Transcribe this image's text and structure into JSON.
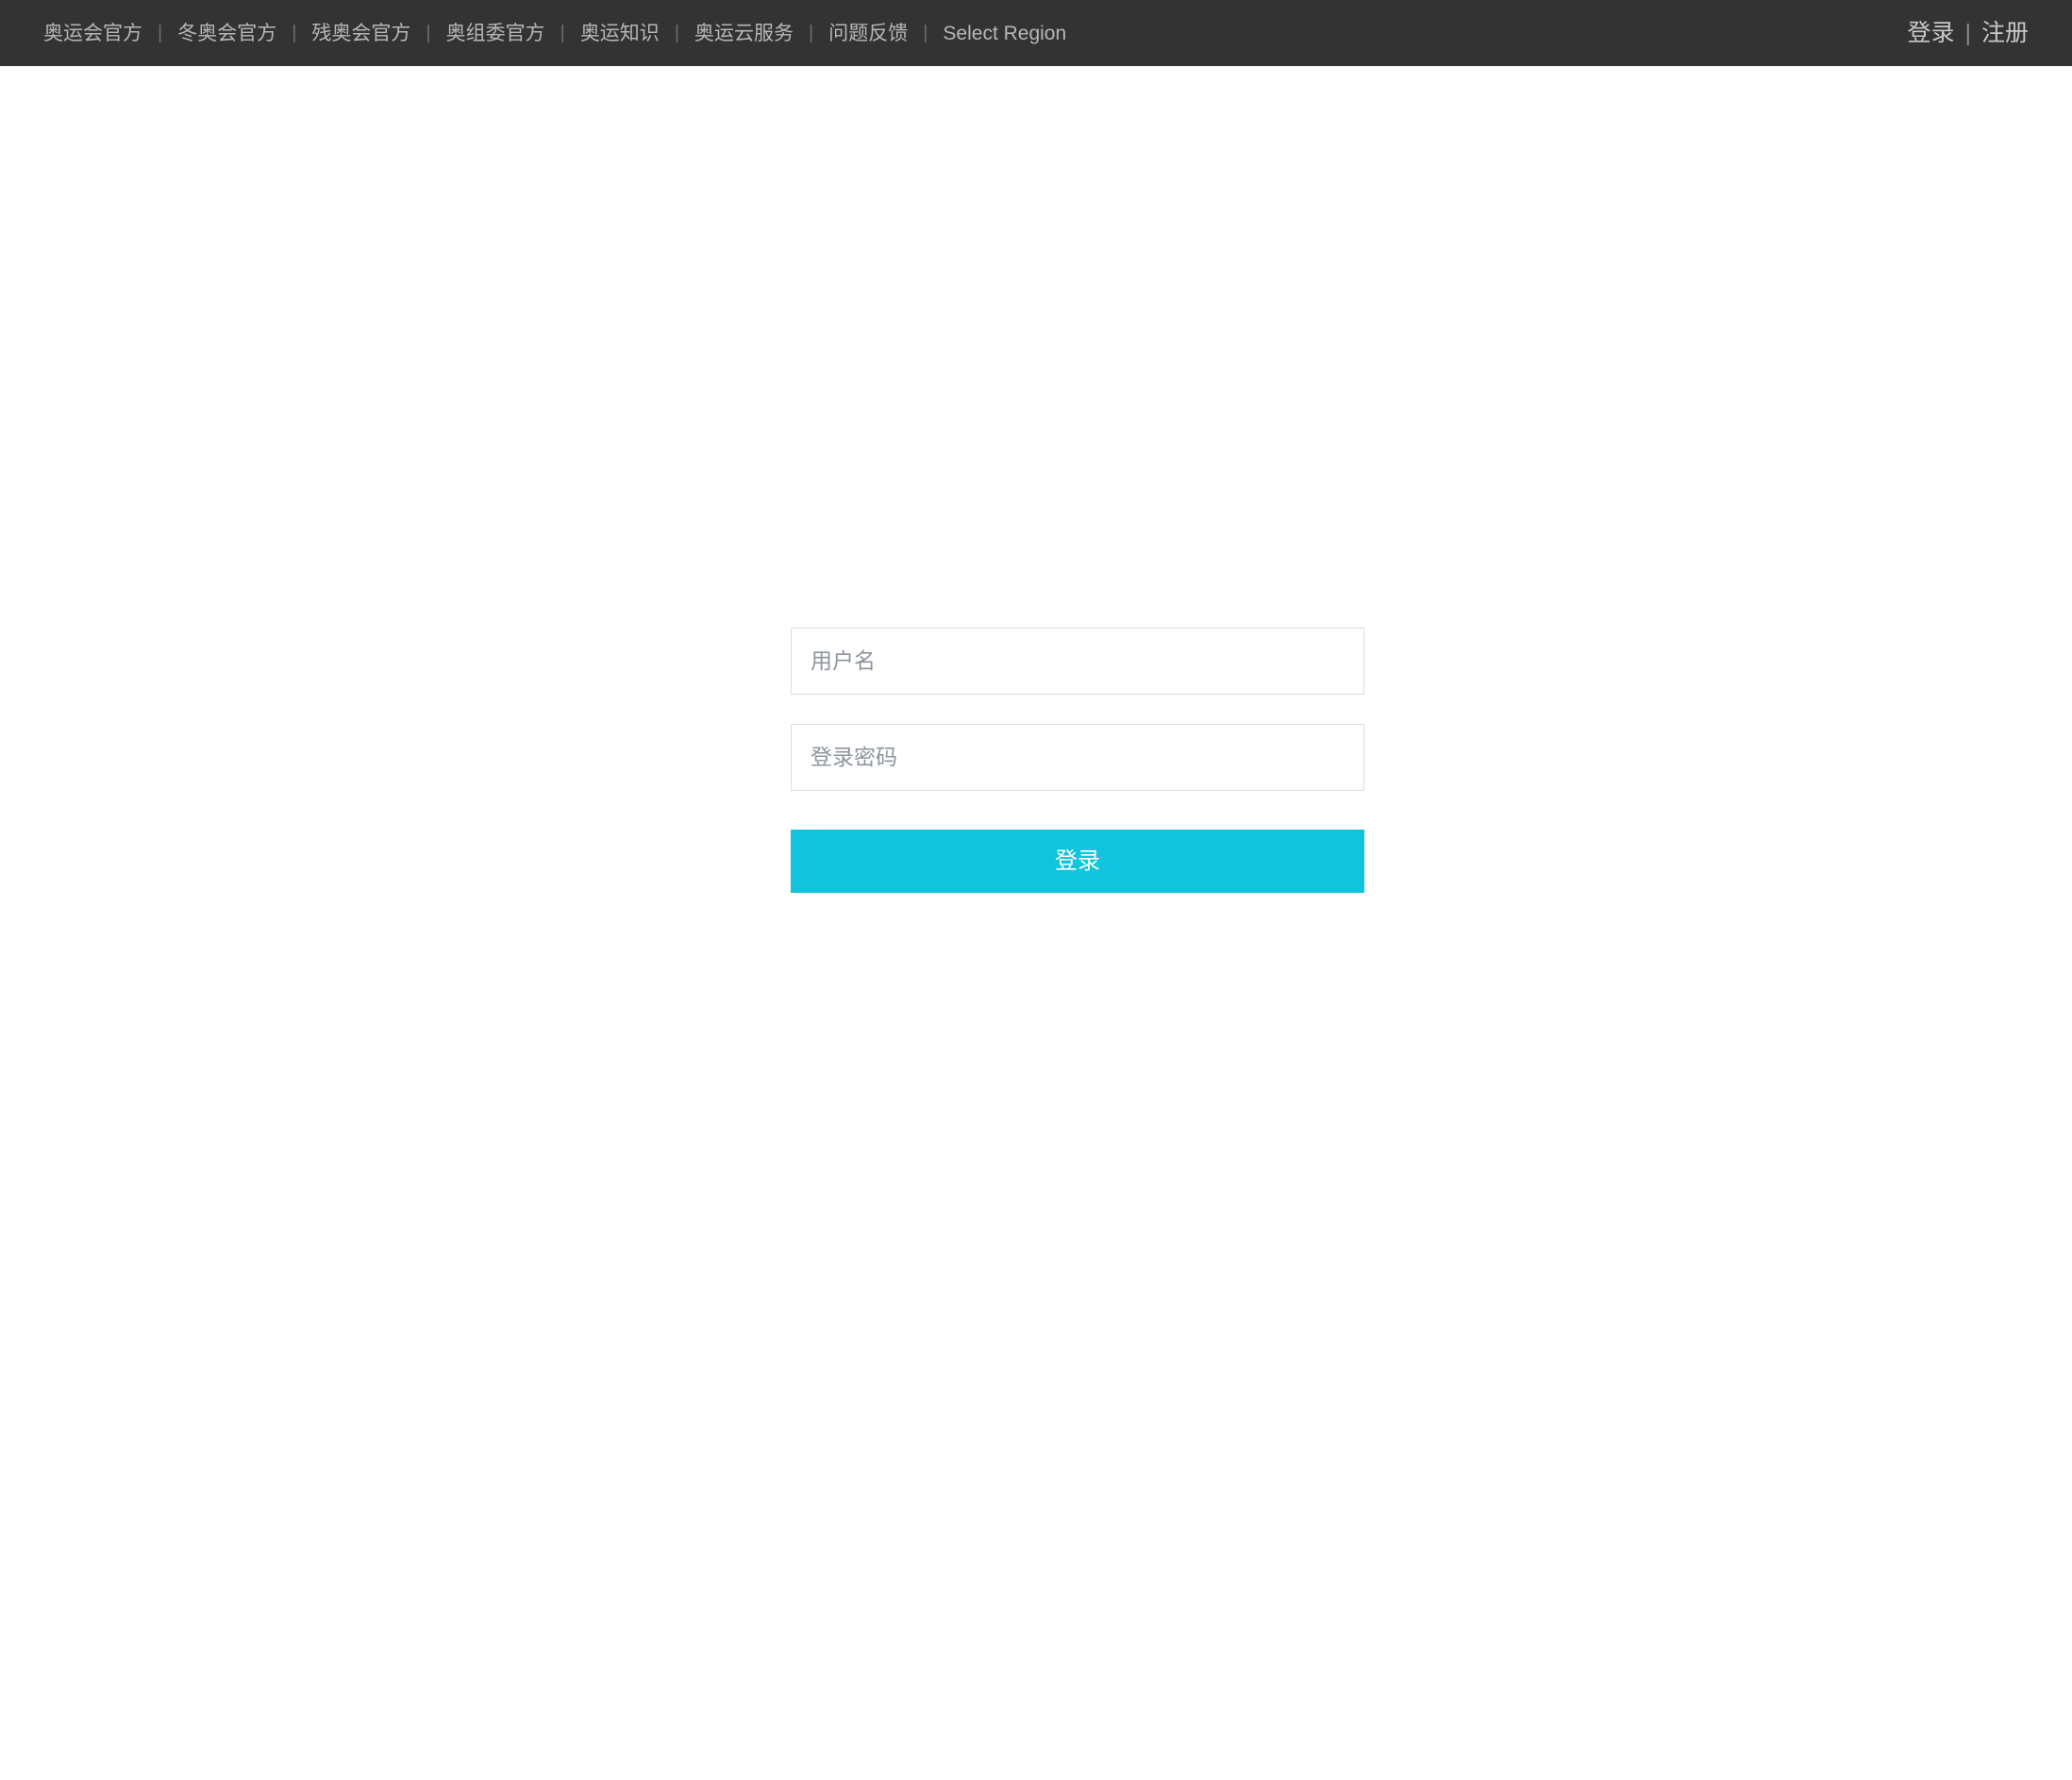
{
  "topbar": {
    "background_color": "#333333",
    "nav_items": [
      {
        "label": "奥运会官方"
      },
      {
        "label": "冬奥会官方"
      },
      {
        "label": "残奥会官方"
      },
      {
        "label": "奥组委官方"
      },
      {
        "label": "奥运知识"
      },
      {
        "label": "奥运云服务"
      },
      {
        "label": "问题反馈"
      },
      {
        "label": "Select Region"
      }
    ],
    "separator": "|",
    "auth": {
      "login_label": "登录",
      "separator": "|",
      "register_label": "注册"
    }
  },
  "login_form": {
    "username": {
      "placeholder": "用户名",
      "value": ""
    },
    "password": {
      "placeholder": "登录密码",
      "value": ""
    },
    "submit_label": "登录",
    "accent_color": "#0fc4dc",
    "border_color": "#dddddd",
    "placeholder_color": "#8d949c"
  }
}
